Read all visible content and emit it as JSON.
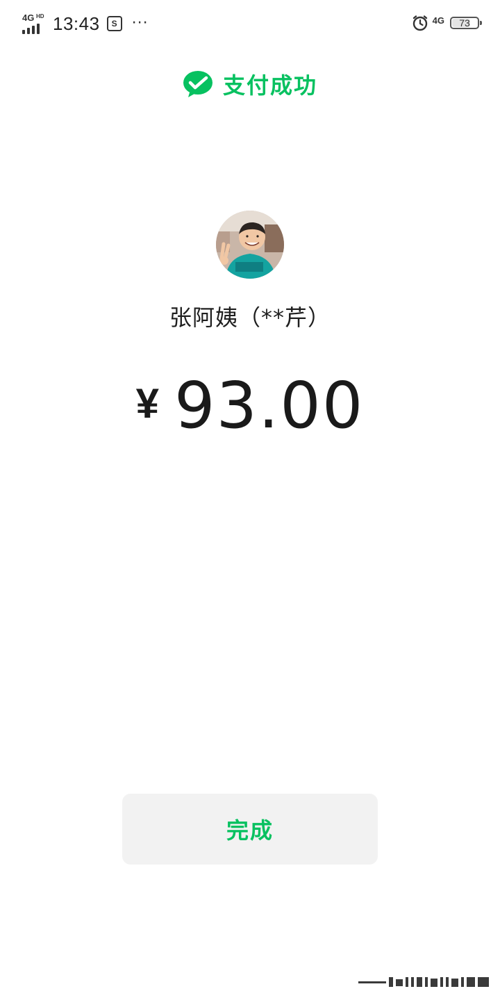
{
  "status_bar": {
    "network_left": "4G",
    "network_left_hd": "HD",
    "time": "13:43",
    "app_indicator": "S",
    "more": "···",
    "network_right": "4G",
    "battery_level": "73",
    "battery_fraction": 0.73,
    "icons": [
      "signal-icon",
      "app-notification-icon",
      "more-icon",
      "alarm-icon",
      "network-icon",
      "battery-icon"
    ]
  },
  "header": {
    "title": "支付成功",
    "icon": "wechat-pay-check-icon"
  },
  "payee": {
    "name": "张阿姨（**芹）",
    "avatar": "avatar"
  },
  "amount": {
    "currency": "¥",
    "value": "93.00"
  },
  "actions": {
    "done_label": "完成"
  },
  "colors": {
    "brand_green": "#07c160",
    "text_primary": "#1a1a1a",
    "button_bg": "#f2f2f2",
    "background": "#ffffff"
  }
}
